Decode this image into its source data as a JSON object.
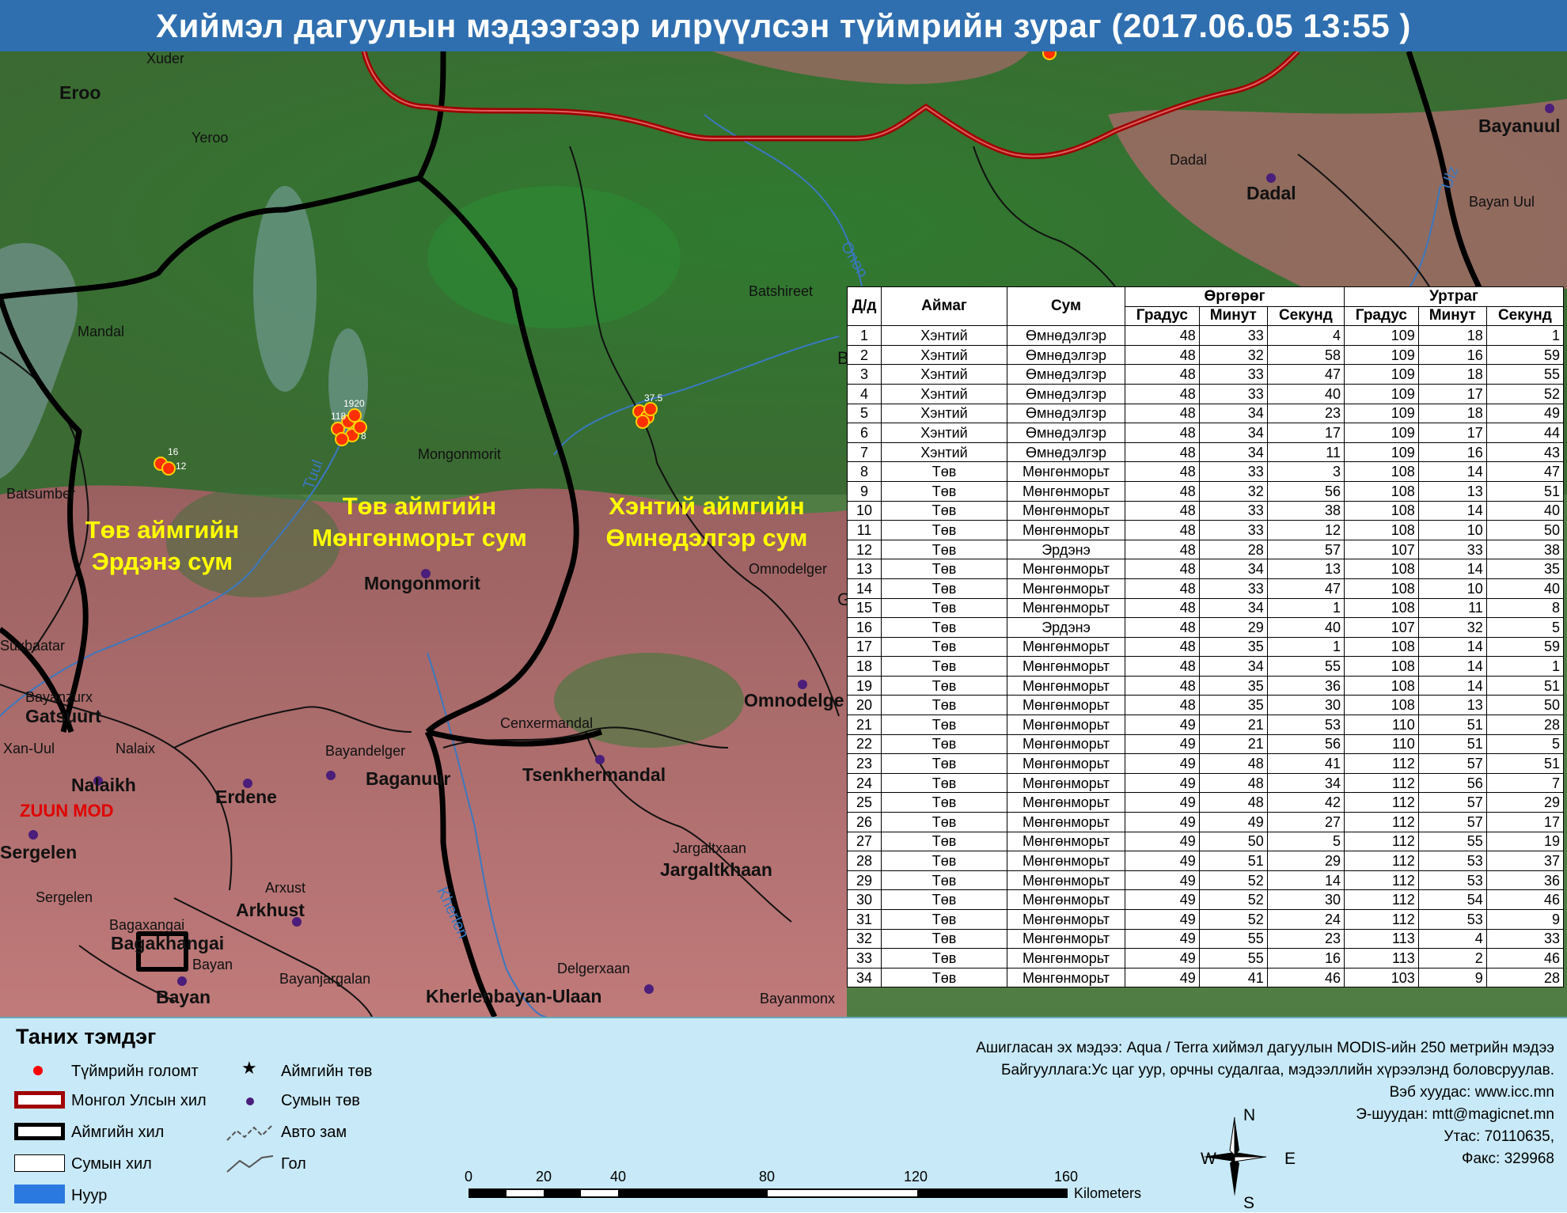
{
  "title": "Хиймэл дагуулын мэдээгээр илрүүлсэн түймрийн зураг  (2017.06.05  13:55 )",
  "map": {
    "region_labels": [
      {
        "line1": "Төв аймгийн",
        "line2": "Эрдэнэ сум"
      },
      {
        "line1": "Төв аймгийн",
        "line2": "Мөнгөнморьт сум"
      },
      {
        "line1": "Хэнтий аймгийн",
        "line2": "Өмнөдэлгэр сум"
      }
    ],
    "place_labels": {
      "xuder": "Xuder",
      "eroo": "Eroo",
      "yeroo": "Yeroo",
      "mandal": "Mandal",
      "batsumber": "Batsumber",
      "suxbaatar": "Suxbaatar",
      "bayanzurx": "Bayanzurx",
      "gatsuurt": "Gatsuurt",
      "khan_uul": "Xan-Uul",
      "nalaix": "Nalaix",
      "nalaikh": "Nalaikh",
      "zuun_mod": "ZUUN MOD",
      "sergelen_bold": "Sergelen",
      "sergelen": "Sergelen",
      "bagaxangai": "Bagaxangai",
      "bagakhangai": "Bagakhangai",
      "bayan_small": "Bayan",
      "bayan_bold": "Bayan",
      "erdene": "Erdene",
      "arxust": "Arxust",
      "arkhust": "Arkhust",
      "bayanjargalan": "Bayanjargalan",
      "bayandelger": "Bayandelger",
      "baganuur": "Baganuur",
      "mongonmorit_small": "Mongonmorit",
      "mongonmorit_bold": "Mongonmorit",
      "cenxermandal": "Cenxermandal",
      "tsenkhermandal": "Tsenkhermandal",
      "delgerxaan": "Delgerxaan",
      "kherlenbayan": "Kherlenbayan-Ulaan",
      "jargaltxaan": "Jargaltxaan",
      "jargaltkhaan": "Jargaltkhaan",
      "bayanmonx": "Bayanmonx",
      "omnodelger_small": "Omnodelger",
      "omnodelger_bold": "Omnodelge",
      "batshireet": "Batshireet",
      "dadal_small": "Dadal",
      "dadal_bold": "Dadal",
      "bayanuul_bold": "Bayanuul",
      "bayan_uul": "Bayan Uul",
      "tuul": "Tuul",
      "onon": "Onon",
      "kherlen": "Kherlen",
      "ulz": "Ulz",
      "b_edge": "B",
      "g_edge": "G"
    },
    "fire_cluster_labels": {
      "c1_a": "16",
      "c1_b": "12",
      "c2_a": "1920",
      "c2_b": "118",
      "c2_c": "8",
      "c3": "37.5"
    }
  },
  "table": {
    "headers": {
      "num": "Д/д",
      "aimag": "Аймаг",
      "sum": "Сум",
      "latitude": "Өргөрөг",
      "longitude": "Уртраг",
      "deg": "Градус",
      "min": "Минут",
      "sec": "Секунд"
    },
    "rows": [
      [
        "1",
        "Хэнтий",
        "Өмнөдэлгэр",
        "48",
        "33",
        "4",
        "109",
        "18",
        "1"
      ],
      [
        "2",
        "Хэнтий",
        "Өмнөдэлгэр",
        "48",
        "32",
        "58",
        "109",
        "16",
        "59"
      ],
      [
        "3",
        "Хэнтий",
        "Өмнөдэлгэр",
        "48",
        "33",
        "47",
        "109",
        "18",
        "55"
      ],
      [
        "4",
        "Хэнтий",
        "Өмнөдэлгэр",
        "48",
        "33",
        "40",
        "109",
        "17",
        "52"
      ],
      [
        "5",
        "Хэнтий",
        "Өмнөдэлгэр",
        "48",
        "34",
        "23",
        "109",
        "18",
        "49"
      ],
      [
        "6",
        "Хэнтий",
        "Өмнөдэлгэр",
        "48",
        "34",
        "17",
        "109",
        "17",
        "44"
      ],
      [
        "7",
        "Хэнтий",
        "Өмнөдэлгэр",
        "48",
        "34",
        "11",
        "109",
        "16",
        "43"
      ],
      [
        "8",
        "Төв",
        "Мөнгөнморьт",
        "48",
        "33",
        "3",
        "108",
        "14",
        "47"
      ],
      [
        "9",
        "Төв",
        "Мөнгөнморьт",
        "48",
        "32",
        "56",
        "108",
        "13",
        "51"
      ],
      [
        "10",
        "Төв",
        "Мөнгөнморьт",
        "48",
        "33",
        "38",
        "108",
        "14",
        "40"
      ],
      [
        "11",
        "Төв",
        "Мөнгөнморьт",
        "48",
        "33",
        "12",
        "108",
        "10",
        "50"
      ],
      [
        "12",
        "Төв",
        "Эрдэнэ",
        "48",
        "28",
        "57",
        "107",
        "33",
        "38"
      ],
      [
        "13",
        "Төв",
        "Мөнгөнморьт",
        "48",
        "34",
        "13",
        "108",
        "14",
        "35"
      ],
      [
        "14",
        "Төв",
        "Мөнгөнморьт",
        "48",
        "33",
        "47",
        "108",
        "10",
        "40"
      ],
      [
        "15",
        "Төв",
        "Мөнгөнморьт",
        "48",
        "34",
        "1",
        "108",
        "11",
        "8"
      ],
      [
        "16",
        "Төв",
        "Эрдэнэ",
        "48",
        "29",
        "40",
        "107",
        "32",
        "5"
      ],
      [
        "17",
        "Төв",
        "Мөнгөнморьт",
        "48",
        "35",
        "1",
        "108",
        "14",
        "59"
      ],
      [
        "18",
        "Төв",
        "Мөнгөнморьт",
        "48",
        "34",
        "55",
        "108",
        "14",
        "1"
      ],
      [
        "19",
        "Төв",
        "Мөнгөнморьт",
        "48",
        "35",
        "36",
        "108",
        "14",
        "51"
      ],
      [
        "20",
        "Төв",
        "Мөнгөнморьт",
        "48",
        "35",
        "30",
        "108",
        "13",
        "50"
      ],
      [
        "21",
        "Төв",
        "Мөнгөнморьт",
        "49",
        "21",
        "53",
        "110",
        "51",
        "28"
      ],
      [
        "22",
        "Төв",
        "Мөнгөнморьт",
        "49",
        "21",
        "56",
        "110",
        "51",
        "5"
      ],
      [
        "23",
        "Төв",
        "Мөнгөнморьт",
        "49",
        "48",
        "41",
        "112",
        "57",
        "51"
      ],
      [
        "24",
        "Төв",
        "Мөнгөнморьт",
        "49",
        "48",
        "34",
        "112",
        "56",
        "7"
      ],
      [
        "25",
        "Төв",
        "Мөнгөнморьт",
        "49",
        "48",
        "42",
        "112",
        "57",
        "29"
      ],
      [
        "26",
        "Төв",
        "Мөнгөнморьт",
        "49",
        "49",
        "27",
        "112",
        "57",
        "17"
      ],
      [
        "27",
        "Төв",
        "Мөнгөнморьт",
        "49",
        "50",
        "5",
        "112",
        "55",
        "19"
      ],
      [
        "28",
        "Төв",
        "Мөнгөнморьт",
        "49",
        "51",
        "29",
        "112",
        "53",
        "37"
      ],
      [
        "29",
        "Төв",
        "Мөнгөнморьт",
        "49",
        "52",
        "14",
        "112",
        "53",
        "36"
      ],
      [
        "30",
        "Төв",
        "Мөнгөнморьт",
        "49",
        "52",
        "30",
        "112",
        "54",
        "46"
      ],
      [
        "31",
        "Төв",
        "Мөнгөнморьт",
        "49",
        "52",
        "24",
        "112",
        "53",
        "9"
      ],
      [
        "32",
        "Төв",
        "Мөнгөнморьт",
        "49",
        "55",
        "23",
        "113",
        "4",
        "33"
      ],
      [
        "33",
        "Төв",
        "Мөнгөнморьт",
        "49",
        "55",
        "16",
        "113",
        "2",
        "46"
      ],
      [
        "34",
        "Төв",
        "Мөнгөнморьт",
        "49",
        "41",
        "46",
        "103",
        "9",
        "28"
      ]
    ]
  },
  "legend": {
    "title": "Таних тэмдэг",
    "fire_point": "Түймрийн голомт",
    "country_border": "Монгол Улсын хил",
    "aimag_border": "Аймгийн хил",
    "sum_border": "Сумын хил",
    "lake": "Нуур",
    "aimag_center": "Аймгийн төв",
    "sum_center": "Сумын төв",
    "road": "Авто зам",
    "river": "Гол"
  },
  "credits": {
    "line1": "Ашигласан эх мэдээ: Aqua / Terra хиймэл дагуулын MODIS-ийн 250 метрийн мэдээ",
    "line2": "Байгууллага:Ус цаг уур, орчны судалгаа, мэдээллийн хүрээлэнд боловсруулав.",
    "line3": "Вэб хуудас: www.icc.mn",
    "line4": "Э-шуудан: mtt@magicnet.mn",
    "line5": "Утас: 70110635,",
    "line6": "Факс: 329968"
  },
  "scale": {
    "ticks": [
      "0",
      "20",
      "40",
      "80",
      "120",
      "160"
    ],
    "unit": "Kilometers"
  },
  "compass": {
    "n": "N",
    "s": "S",
    "e": "E",
    "w": "W"
  },
  "colors": {
    "title_bar": "#2f6fb0",
    "legend_bg": "#c8e9f7",
    "fire": "#ff0000",
    "country_border": "#a00000",
    "region_label": "#ffff00"
  }
}
